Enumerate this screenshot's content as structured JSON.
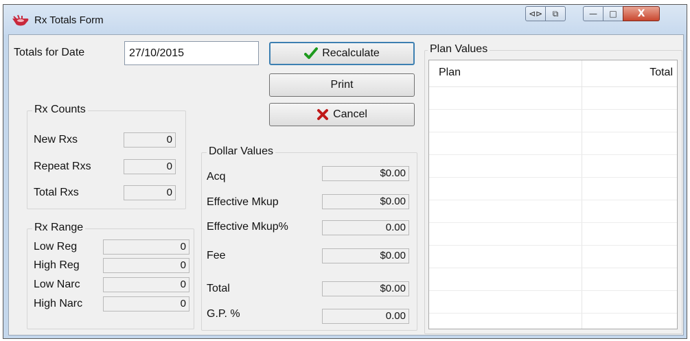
{
  "window": {
    "title": "Rx Totals Form",
    "close_glyph": "X",
    "minimize_glyph": "—",
    "maximize_glyph": "□",
    "nav_glyph": "⊲⊳",
    "copy_glyph": "⧉"
  },
  "header": {
    "date_label": "Totals for Date",
    "date_value": "27/10/2015"
  },
  "buttons": {
    "recalculate": "Recalculate",
    "print": "Print",
    "cancel": "Cancel"
  },
  "rx_counts": {
    "title": "Rx Counts",
    "new_label": "New Rxs",
    "new_value": "0",
    "repeat_label": "Repeat Rxs",
    "repeat_value": "0",
    "total_label": "Total Rxs",
    "total_value": "0"
  },
  "rx_range": {
    "title": "Rx Range",
    "low_reg_label": "Low Reg",
    "low_reg_value": "0",
    "high_reg_label": "High Reg",
    "high_reg_value": "0",
    "low_narc_label": "Low Narc",
    "low_narc_value": "0",
    "high_narc_label": "High Narc",
    "high_narc_value": "0"
  },
  "dollar_values": {
    "title": "Dollar Values",
    "acq_label": "Acq",
    "acq_value": "$0.00",
    "eff_mkup_label": "Effective Mkup",
    "eff_mkup_value": "$0.00",
    "eff_mkup_pct_label": "Effective Mkup%",
    "eff_mkup_pct_value": "0.00",
    "fee_label": "Fee",
    "fee_value": "$0.00",
    "total_label": "Total",
    "total_value": "$0.00",
    "gp_label": "G.P. %",
    "gp_value": "0.00"
  },
  "plan_values": {
    "title": "Plan Values",
    "columns": [
      "Plan",
      "Total"
    ]
  },
  "colors": {
    "accept_green": "#1e9a1e",
    "cancel_red": "#c01818",
    "title_icon_red": "#c8283c"
  }
}
